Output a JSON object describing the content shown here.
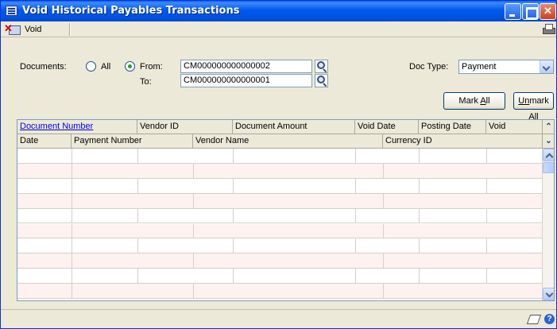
{
  "window": {
    "title": "Void Historical Payables Transactions"
  },
  "toolbar": {
    "void_label": "Void"
  },
  "filters": {
    "documents_label": "Documents:",
    "all_label": "All",
    "from_label": "From:",
    "to_label": "To:",
    "from_value": "CM000000000000002",
    "to_value": "CM000000000000001",
    "selected_option": "From",
    "doc_type_label": "Doc Type:",
    "doc_type_value": "Payment"
  },
  "buttons": {
    "mark_all_pre": "Mark ",
    "mark_all_acc": "A",
    "mark_all_post": "ll",
    "unmark_all_pre": "U",
    "unmark_all_acc": "n",
    "unmark_all_post": "mark All"
  },
  "grid": {
    "header_row1": [
      "Document Number",
      "Vendor ID",
      "Document Amount",
      "Void Date",
      "Posting Date",
      "Void"
    ],
    "header_row2": [
      "Date",
      "Payment Number",
      "Vendor Name",
      "Currency ID"
    ],
    "row_count": 10
  },
  "icons": {
    "close_glyph": "✕",
    "collapse_glyph": "⌃",
    "expand_glyph": "⌄",
    "help_glyph": "?"
  }
}
